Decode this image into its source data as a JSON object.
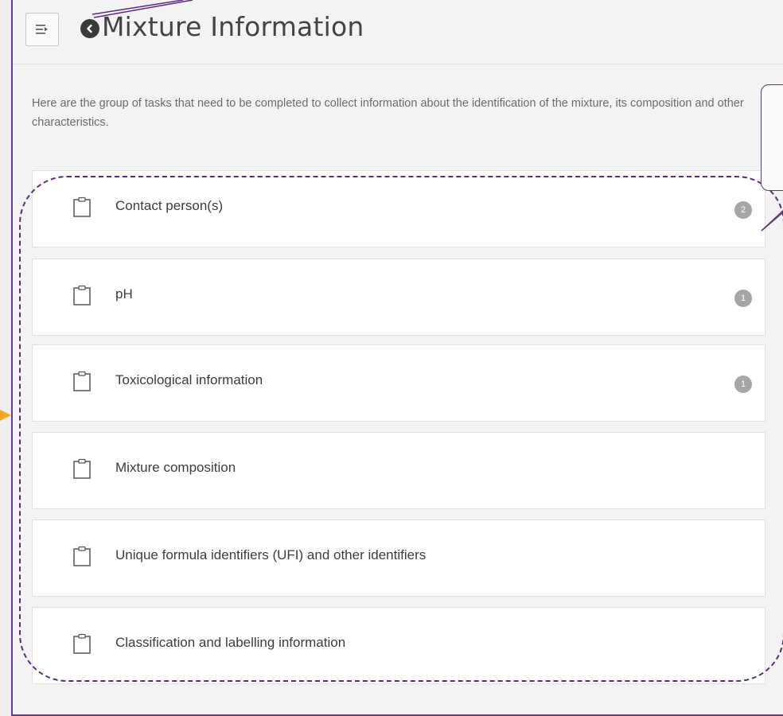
{
  "header": {
    "title": "Mixture Information",
    "menu_icon": "menu-collapse-icon",
    "back_icon": "back-circle-icon"
  },
  "intro": "Here are the group of tasks that need to be completed to collect information about the identification of the mixture, its composition and other characteristics.",
  "tasks": [
    {
      "label": "Contact person(s)",
      "badge": "2",
      "icon": "clipboard-icon"
    },
    {
      "label": "pH",
      "badge": "1",
      "icon": "clipboard-icon"
    },
    {
      "label": "Toxicological information",
      "badge": "1",
      "icon": "clipboard-icon"
    },
    {
      "label": "Mixture composition",
      "badge": "",
      "icon": "clipboard-icon"
    },
    {
      "label": "Unique formula identifiers (UFI) and other identifiers",
      "badge": "",
      "icon": "clipboard-icon"
    },
    {
      "label": "Classification and labelling information",
      "badge": "",
      "icon": "clipboard-icon"
    }
  ],
  "colors": {
    "annotation_purple": "#5b2a7e",
    "arrow_orange": "#f5a623",
    "badge_gray": "#a6a6a6"
  }
}
